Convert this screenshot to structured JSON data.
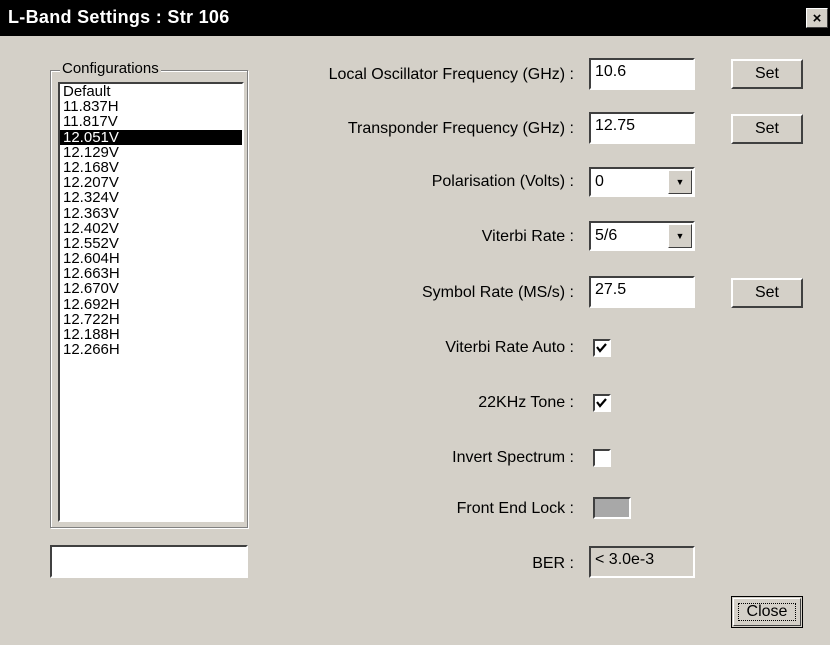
{
  "window": {
    "title": "L-Band Settings : Str 106",
    "close_glyph": "×"
  },
  "configurations": {
    "label": "Configurations",
    "items": [
      "Default",
      "11.837H",
      "11.817V",
      "12.051V",
      "12.129V",
      "12.168V",
      "12.207V",
      "12.324V",
      "12.363V",
      "12.402V",
      "12.552V",
      "12.604H",
      "12.663H",
      "12.670V",
      "12.692H",
      "12.722H",
      "12.188H",
      "12.266H"
    ],
    "selected_index": 3,
    "name_value": ""
  },
  "fields": {
    "lo_freq": {
      "label": "Local Oscillator Frequency (GHz) :",
      "value": "10.6",
      "set_label": "Set"
    },
    "transponder_freq": {
      "label": "Transponder Frequency (GHz) :",
      "value": "12.75",
      "set_label": "Set"
    },
    "polarisation": {
      "label": "Polarisation (Volts) :",
      "value": "0"
    },
    "viterbi_rate": {
      "label": "Viterbi Rate :",
      "value": "5/6"
    },
    "symbol_rate": {
      "label": "Symbol Rate (MS/s) :",
      "value": "27.5",
      "set_label": "Set"
    },
    "viterbi_auto": {
      "label": "Viterbi Rate Auto :",
      "checked": true
    },
    "tone_22k": {
      "label": "22KHz Tone :",
      "checked": true
    },
    "invert_spectrum": {
      "label": "Invert Spectrum :",
      "checked": false
    },
    "front_end_lock": {
      "label": "Front End Lock :"
    },
    "ber": {
      "label": "BER :",
      "value": "< 3.0e-3"
    }
  },
  "buttons": {
    "close_label": "Close"
  },
  "icons": {
    "check": "checkmark-icon",
    "dropdown": "chevron-down-icon"
  }
}
